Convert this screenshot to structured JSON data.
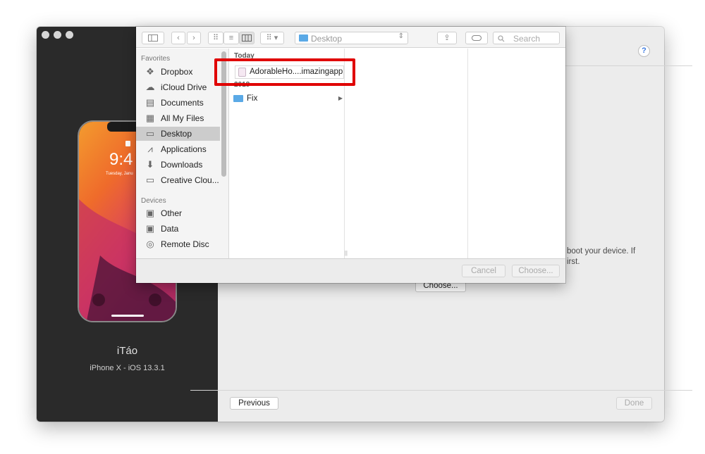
{
  "device": {
    "name": "iTáo",
    "info": "iPhone X - iOS 13.3.1"
  },
  "phone_screen": {
    "time": "9:4",
    "date": "Tuesday, Janu"
  },
  "main": {
    "help_label": "?",
    "instruction_line1": "boot your device. If",
    "instruction_line2": "irst.",
    "choose_label": "Choose...",
    "previous_label": "Previous",
    "done_label": "Done"
  },
  "dialog": {
    "location": "Desktop",
    "search_placeholder": "Search",
    "sidebar": {
      "favorites_header": "Favorites",
      "favorites": [
        {
          "label": "Dropbox",
          "icon": "dropbox-icon"
        },
        {
          "label": "iCloud Drive",
          "icon": "cloud-icon"
        },
        {
          "label": "Documents",
          "icon": "document-icon"
        },
        {
          "label": "All My Files",
          "icon": "files-icon"
        },
        {
          "label": "Desktop",
          "icon": "desktop-icon"
        },
        {
          "label": "Applications",
          "icon": "applications-icon"
        },
        {
          "label": "Downloads",
          "icon": "download-icon"
        },
        {
          "label": "Creative Clou...",
          "icon": "folder-icon"
        }
      ],
      "devices_header": "Devices",
      "devices": [
        {
          "label": "Other",
          "icon": "disk-icon"
        },
        {
          "label": "Data",
          "icon": "disk-icon"
        },
        {
          "label": "Remote Disc",
          "icon": "disc-icon"
        }
      ]
    },
    "column1": {
      "section_today": "Today",
      "file_name": "AdorableHo....imazingapp",
      "section_year": "2018",
      "folder_name": "Fix"
    },
    "cancel_label": "Cancel",
    "choose_label": "Choose..."
  },
  "colors": {
    "highlight": "#e00000",
    "selected_row": "#cccccc",
    "folder_blue": "#5aa9e6"
  }
}
